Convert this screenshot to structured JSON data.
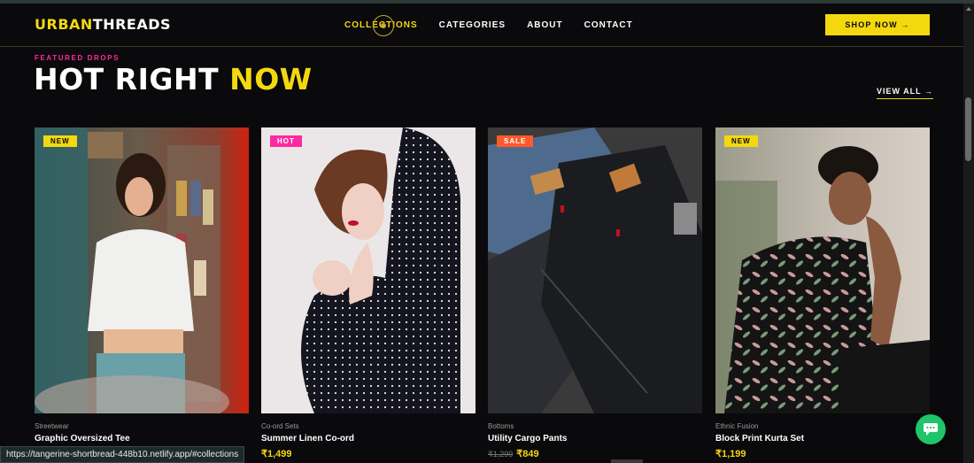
{
  "brand": {
    "part1": "URBAN",
    "part2": "THREADS"
  },
  "nav": {
    "links": [
      "COLLECTIONS",
      "CATEGORIES",
      "ABOUT",
      "CONTACT"
    ],
    "active_index": 0,
    "cta": "SHOP NOW →"
  },
  "section": {
    "eyebrow": "FEATURED DROPS",
    "title_main": "HOT RIGHT ",
    "title_highlight": "NOW",
    "view_all": "VIEW ALL →"
  },
  "products": [
    {
      "badge": "NEW",
      "badge_color": "#f4d80f",
      "category": "Streetwear",
      "name": "Graphic Oversized Tee",
      "price": "",
      "old_price": ""
    },
    {
      "badge": "HOT",
      "badge_color": "#ff2aa1",
      "category": "Co-ord Sets",
      "name": "Summer Linen Co-ord",
      "price": "₹1,499",
      "old_price": ""
    },
    {
      "badge": "SALE",
      "badge_color": "#ff5a2a",
      "category": "Bottoms",
      "name": "Utility Cargo Pants",
      "price": "₹849",
      "old_price": "₹1,299"
    },
    {
      "badge": "NEW",
      "badge_color": "#f4d80f",
      "category": "Ethnic Fusion",
      "name": "Block Print Kurta Set",
      "price": "₹1,199",
      "old_price": ""
    }
  ],
  "status_url": "https://tangerine-shortbread-448b10.netlify.app/#collections",
  "colors": {
    "accent": "#f4d80f",
    "pink": "#ff2aa1",
    "background": "#0a090b",
    "chat": "#1fc46b"
  },
  "icons": {
    "chat": "chat-bubble-icon",
    "cursor": "cursor-ring-icon"
  }
}
